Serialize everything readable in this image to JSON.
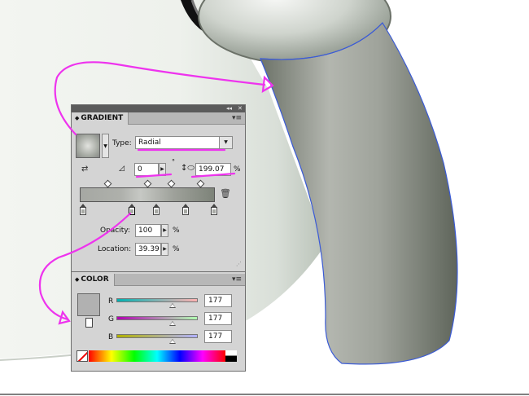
{
  "gradient_panel": {
    "title": "GRADIENT",
    "type_label": "Type:",
    "type_value": "Radial",
    "angle_value": "0",
    "degree_symbol": "°",
    "aspect_value": "199.07",
    "aspect_unit": "%",
    "opacity_label": "Opacity:",
    "opacity_value": "100",
    "opacity_unit": "%",
    "location_label": "Location:",
    "location_value": "39.39",
    "location_unit": "%"
  },
  "color_panel": {
    "title": "COLOR",
    "swatch_color": "#b1b1b1",
    "channels": [
      {
        "label": "R",
        "value": "177"
      },
      {
        "label": "G",
        "value": "177"
      },
      {
        "label": "B",
        "value": "177"
      }
    ]
  },
  "colors": {
    "annotation": "#ee33ee",
    "selection": "#3b5bd6",
    "panel_bg": "#d4d4d4",
    "titlebar": "#5b5b5b"
  },
  "icons": [
    "gradient-swatch-icon",
    "dropdown-arrow-icon",
    "reverse-gradient-icon",
    "angle-icon",
    "aspect-ratio-icon",
    "trash-icon",
    "panel-menu-icon",
    "collapse-icon",
    "close-icon",
    "none-swatch-icon"
  ]
}
